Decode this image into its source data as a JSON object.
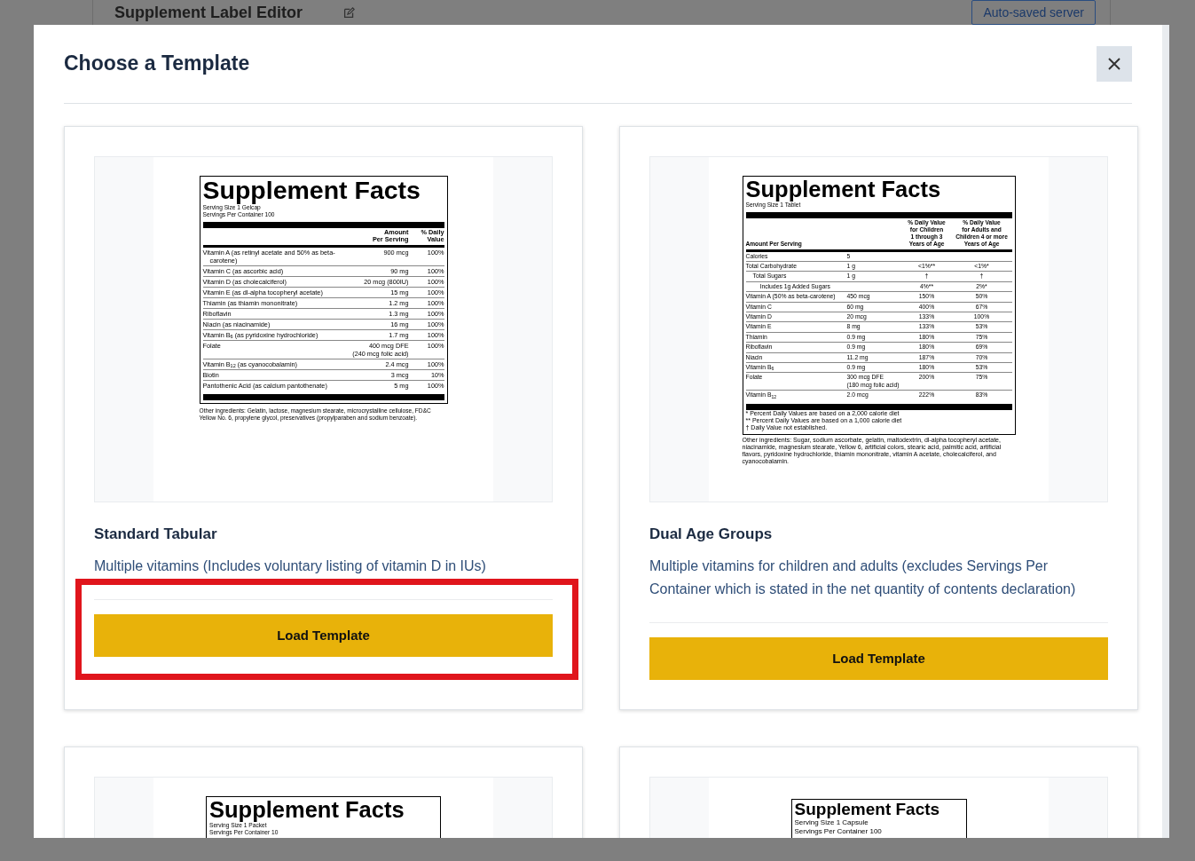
{
  "app": {
    "title": "Supplement Label Editor",
    "save_status": "Auto-saved server"
  },
  "modal": {
    "title": "Choose a Template"
  },
  "templates": [
    {
      "name": "Standard Tabular",
      "description": "Multiple vitamins (Includes voluntary listing of vitamin D in IUs)",
      "button": "Load Template",
      "highlighted": true,
      "label": {
        "kind": "single",
        "title": "Supplement Facts",
        "serving": [
          "Serving Size 1 Gelcap",
          "Servings Per Container 100"
        ],
        "columns": [
          "Amount\nPer Serving",
          "% Daily\nValue"
        ],
        "rows": [
          {
            "nutrient": "Vitamin A (as retinyl acetate and 50% as beta-carotene)",
            "amount": "900 mcg",
            "daily_value": "100%"
          },
          {
            "nutrient": "Vitamin C (as ascorbic acid)",
            "amount": "90 mg",
            "daily_value": "100%"
          },
          {
            "nutrient": "Vitamin D (as cholecalciferol)",
            "amount": "20 mcg (800IU)",
            "daily_value": "100%"
          },
          {
            "nutrient": "Vitamin E (as dl-alpha tocopheryl acetate)",
            "amount": "15 mg",
            "daily_value": "100%"
          },
          {
            "nutrient": "Thiamin (as thiamin mononitrate)",
            "amount": "1.2 mg",
            "daily_value": "100%"
          },
          {
            "nutrient": "Riboflavin",
            "amount": "1.3 mg",
            "daily_value": "100%"
          },
          {
            "nutrient": "Niacin (as niacinamide)",
            "amount": "16 mg",
            "daily_value": "100%"
          },
          {
            "nutrient": "Vitamin B$_{6}$ (as pyridoxine hydrochloride)",
            "amount": "1.7 mg",
            "daily_value": "100%"
          },
          {
            "nutrient": "Folate",
            "amount": "400 mcg DFE",
            "amount_note": "(240 mcg folic acid)",
            "daily_value": "100%"
          },
          {
            "nutrient": "Vitamin B$_{12}$ (as cyanocobalamin)",
            "amount": "2.4 mcg",
            "daily_value": "100%"
          },
          {
            "nutrient": "Biotin",
            "amount": "3 mcg",
            "daily_value": "10%"
          },
          {
            "nutrient": "Pantothenic Acid (as calcium pantothenate)",
            "amount": "5 mg",
            "daily_value": "100%"
          }
        ],
        "other_ingredients": "Other ingredients: Gelatin, lactose, magnesium stearate, microcrystalline cellulose, FD&C Yellow No. 6, propylene glycol, preservatives (propylparaben and sodium benzoate)."
      }
    },
    {
      "name": "Dual Age Groups",
      "description": "Multiple vitamins for children and adults (excludes Servings Per Container which is stated in the net quantity of contents declaration)",
      "button": "Load Template",
      "highlighted": false,
      "label": {
        "kind": "dual",
        "title": "Supplement Facts",
        "serving": [
          "Serving Size 1 Tablet"
        ],
        "columns": [
          "Amount Per Serving",
          "% Daily Value\nfor Children\n1 through 3\nYears of Age",
          "% Daily Value\nfor Adults and\nChildren 4 or more\nYears of Age"
        ],
        "rows": [
          {
            "nutrient": "Calories",
            "amount": "5"
          },
          {
            "nutrient": "Total Carbohydrate",
            "amount": "1 g",
            "dv_children": "<1%**",
            "dv_adults": "<1%*",
            "children": [
              {
                "nutrient": "Total Sugars",
                "amount": "1 g",
                "dv_children": "†",
                "dv_adults": "†",
                "children": [
                  {
                    "nutrient": "Includes 1g Added Sugars",
                    "dv_children": "4%**",
                    "dv_adults": "2%*"
                  }
                ]
              }
            ]
          },
          {
            "nutrient": "Vitamin A (50% as beta-carotene)",
            "amount": "450 mcg",
            "dv_children": "150%",
            "dv_adults": "50%"
          },
          {
            "nutrient": "Vitamin C",
            "amount": "60 mg",
            "dv_children": "400%",
            "dv_adults": "67%"
          },
          {
            "nutrient": "Vitamin D",
            "amount": "20 mcg",
            "dv_children": "133%",
            "dv_adults": "100%"
          },
          {
            "nutrient": "Vitamin E",
            "amount": "8 mg",
            "dv_children": "133%",
            "dv_adults": "53%"
          },
          {
            "nutrient": "Thiamin",
            "amount": "0.9 mg",
            "dv_children": "180%",
            "dv_adults": "75%"
          },
          {
            "nutrient": "Riboflavin",
            "amount": "0.9 mg",
            "dv_children": "180%",
            "dv_adults": "69%"
          },
          {
            "nutrient": "Niacin",
            "amount": "11.2 mg",
            "dv_children": "187%",
            "dv_adults": "70%"
          },
          {
            "nutrient": "Vitamin B$_{6}$",
            "amount": "0.9 mg",
            "dv_children": "180%",
            "dv_adults": "53%"
          },
          {
            "nutrient": "Folate",
            "amount": "300 mcg DFE",
            "amount_note": "(180 mcg folic acid)",
            "dv_children": "200%",
            "dv_adults": "75%"
          },
          {
            "nutrient": "Vitamin B$_{12}$",
            "amount": "2.0 mcg",
            "dv_children": "222%",
            "dv_adults": "83%"
          }
        ],
        "footnotes": [
          "* Percent Daily Values are based on a 2,000 calorie diet",
          "** Percent Daily Values are based on a 1,000 calorie diet",
          "† Daily Value not established."
        ],
        "other_ingredients": "Other ingredients: Sugar, sodium ascorbate, gelatin, maltodextrin, dl-alpha tocopheryl acetate, niacinamide, magnesium stearate, Yellow 6, artificial colors, stearic acid, palmitic acid, artificial flavors, pyridoxine hydrochloride, thiamin mononitrate, vitamin A acetate, cholecalciferol, and cyanocobalamin."
      }
    },
    {
      "label": {
        "kind": "single",
        "title": "Supplement Facts",
        "serving": [
          "Serving Size 1 Packet",
          "Servings Per Container 10"
        ]
      }
    },
    {
      "label": {
        "kind": "single",
        "title": "Supplement Facts",
        "serving": [
          "Serving Size 1 Capsule",
          "Servings Per Container 100"
        ]
      }
    }
  ]
}
